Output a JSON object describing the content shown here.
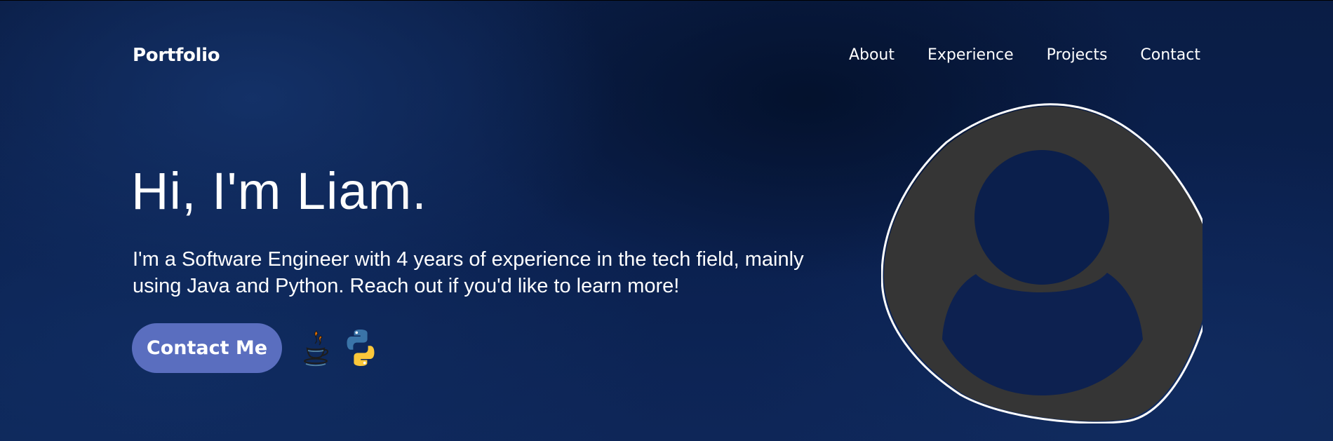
{
  "header": {
    "logo": "Portfolio",
    "nav": [
      {
        "label": "About"
      },
      {
        "label": "Experience"
      },
      {
        "label": "Projects"
      },
      {
        "label": "Contact"
      }
    ]
  },
  "hero": {
    "title": "Hi, I'm Liam.",
    "subtitle": "I'm a Software Engineer with 4 years of experience in the tech field, mainly using Java and Python. Reach out if you'd like to learn more!",
    "cta_label": "Contact Me",
    "tech_icons": [
      "java-icon",
      "python-icon"
    ],
    "avatar_icon": "user-placeholder-icon"
  },
  "colors": {
    "background": "#0b2150",
    "button": "#5a6ebf",
    "avatar_fill": "#353535",
    "text": "#ffffff"
  }
}
